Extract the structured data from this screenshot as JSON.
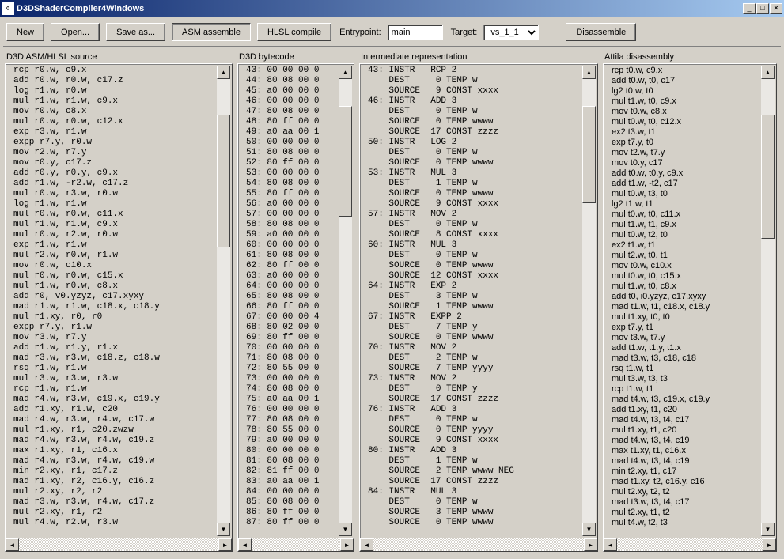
{
  "window": {
    "title": "D3DShaderCompiler4Windows"
  },
  "toolbar": {
    "btn_new": "New",
    "btn_open": "Open...",
    "btn_save": "Save as...",
    "btn_asm": "ASM assemble",
    "btn_hlsl": "HLSL compile",
    "lbl_entry": "Entrypoint:",
    "entry_value": "main",
    "lbl_target": "Target:",
    "target_value": "vs_1_1",
    "btn_disasm": "Disassemble"
  },
  "panels": {
    "asm": {
      "label": "D3D ASM/HLSL source",
      "text": "rcp r0.w, c9.x\nadd r0.w, r0.w, c17.z\nlog r1.w, r0.w\nmul r1.w, r1.w, c9.x\nmov r0.w, c8.x\nmul r0.w, r0.w, c12.x\nexp r3.w, r1.w\nexpp r7.y, r0.w\nmov r2.w, r7.y\nmov r0.y, c17.z\nadd r0.y, r0.y, c9.x\nadd r1.w, -r2.w, c17.z\nmul r0.w, r3.w, r0.w\nlog r1.w, r1.w\nmul r0.w, r0.w, c11.x\nmul r1.w, r1.w, c9.x\nmul r0.w, r2.w, r0.w\nexp r1.w, r1.w\nmul r2.w, r0.w, r1.w\nmov r0.w, c10.x\nmul r0.w, r0.w, c15.x\nmul r1.w, r0.w, c8.x\nadd r0, v0.yzyz, c17.xyxy\nmad r1.w, r1.w, c18.x, c18.y\nmul r1.xy, r0, r0\nexpp r7.y, r1.w\nmov r3.w, r7.y\nadd r1.w, r1.y, r1.x\nmad r3.w, r3.w, c18.z, c18.w\nrsq r1.w, r1.w\nmul r3.w, r3.w, r3.w\nrcp r1.w, r1.w\nmad r4.w, r3.w, c19.x, c19.y\nadd r1.xy, r1.w, c20\nmad r4.w, r3.w, r4.w, c17.w\nmul r1.xy, r1, c20.zwzw\nmad r4.w, r3.w, r4.w, c19.z\nmax r1.xy, r1, c16.x\nmad r4.w, r3.w, r4.w, c19.w\nmin r2.xy, r1, c17.z\nmad r1.xy, r2, c16.y, c16.z\nmul r2.xy, r2, r2\nmad r3.w, r3.w, r4.w, c17.z\nmul r2.xy, r1, r2\nmul r4.w, r2.w, r3.w"
    },
    "bytecode": {
      "label": "D3D bytecode",
      "text": "43: 00 00 00 0\n44: 80 08 00 0\n45: a0 00 00 0\n46: 00 00 00 0\n47: 80 08 00 0\n48: 80 ff 00 0\n49: a0 aa 00 1\n50: 00 00 00 0\n51: 80 08 00 0\n52: 80 ff 00 0\n53: 00 00 00 0\n54: 80 08 00 0\n55: 80 ff 00 0\n56: a0 00 00 0\n57: 00 00 00 0\n58: 80 08 00 0\n59: a0 00 00 0\n60: 00 00 00 0\n61: 80 08 00 0\n62: 80 ff 00 0\n63: a0 00 00 0\n64: 00 00 00 0\n65: 80 08 00 0\n66: 80 ff 00 0\n67: 00 00 00 4\n68: 80 02 00 0\n69: 80 ff 00 0\n70: 00 00 00 0\n71: 80 08 00 0\n72: 80 55 00 0\n73: 00 00 00 0\n74: 80 08 00 0\n75: a0 aa 00 1\n76: 00 00 00 0\n77: 80 08 00 0\n78: 80 55 00 0\n79: a0 00 00 0\n80: 00 00 00 0\n81: 80 08 00 0\n82: 81 ff 00 0\n83: a0 aa 00 1\n84: 00 00 00 0\n85: 80 08 00 0\n86: 80 ff 00 0\n87: 80 ff 00 0"
    },
    "ir": {
      "label": "Intermediate representation",
      "text": "43: INSTR   RCP 2\n    DEST     0 TEMP w\n    SOURCE   9 CONST xxxx\n46: INSTR   ADD 3\n    DEST     0 TEMP w\n    SOURCE   0 TEMP wwww\n    SOURCE  17 CONST zzzz\n50: INSTR   LOG 2\n    DEST     0 TEMP w\n    SOURCE   0 TEMP wwww\n53: INSTR   MUL 3\n    DEST     1 TEMP w\n    SOURCE   0 TEMP wwww\n    SOURCE   9 CONST xxxx\n57: INSTR   MOV 2\n    DEST     0 TEMP w\n    SOURCE   8 CONST xxxx\n60: INSTR   MUL 3\n    DEST     0 TEMP w\n    SOURCE   0 TEMP wwww\n    SOURCE  12 CONST xxxx\n64: INSTR   EXP 2\n    DEST     3 TEMP w\n    SOURCE   1 TEMP wwww\n67: INSTR   EXPP 2\n    DEST     7 TEMP y\n    SOURCE   0 TEMP wwww\n70: INSTR   MOV 2\n    DEST     2 TEMP w\n    SOURCE   7 TEMP yyyy\n73: INSTR   MOV 2\n    DEST     0 TEMP y\n    SOURCE  17 CONST zzzz\n76: INSTR   ADD 3\n    DEST     0 TEMP w\n    SOURCE   0 TEMP yyyy\n    SOURCE   9 CONST xxxx\n80: INSTR   ADD 3\n    DEST     1 TEMP w\n    SOURCE   2 TEMP wwww NEG\n    SOURCE  17 CONST zzzz\n84: INSTR   MUL 3\n    DEST     0 TEMP w\n    SOURCE   3 TEMP wwww\n    SOURCE   0 TEMP wwww"
    },
    "attila": {
      "label": "Attila disassembly",
      "text": "rcp t0.w, c9.x\nadd t0.w, t0, c17\nlg2 t0.w, t0\nmul t1.w, t0, c9.x\nmov t0.w, c8.x\nmul t0.w, t0, c12.x\nex2 t3.w, t1\nexp t7.y, t0\nmov t2.w, t7.y\nmov t0.y, c17\nadd t0.w, t0.y, c9.x\nadd t1.w, -t2, c17\nmul t0.w, t3, t0\nlg2 t1.w, t1\nmul t0.w, t0, c11.x\nmul t1.w, t1, c9.x\nmul t0.w, t2, t0\nex2 t1.w, t1\nmul t2.w, t0, t1\nmov t0.w, c10.x\nmul t0.w, t0, c15.x\nmul t1.w, t0, c8.x\nadd t0, i0.yzyz, c17.xyxy\nmad t1.w, t1, c18.x, c18.y\nmul t1.xy, t0, t0\nexp t7.y, t1\nmov t3.w, t7.y\nadd t1.w, t1.y, t1.x\nmad t3.w, t3, c18, c18\nrsq t1.w, t1\nmul t3.w, t3, t3\nrcp t1.w, t1\nmad t4.w, t3, c19.x, c19.y\nadd t1.xy, t1, c20\nmad t4.w, t3, t4, c17\nmul t1.xy, t1, c20\nmad t4.w, t3, t4, c19\nmax t1.xy, t1, c16.x\nmad t4.w, t3, t4, c19\nmin t2.xy, t1, c17\nmad t1.xy, t2, c16.y, c16\nmul t2.xy, t2, t2\nmad t3.w, t3, t4, c17\nmul t2.xy, t1, t2\nmul t4.w, t2, t3"
    }
  }
}
